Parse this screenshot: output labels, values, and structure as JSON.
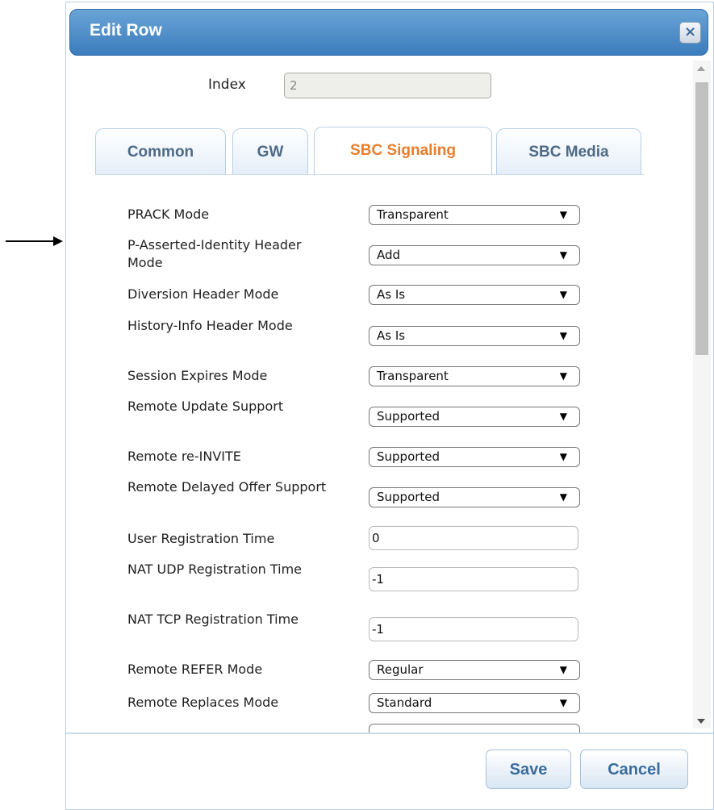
{
  "dialog": {
    "title": "Edit Row",
    "close_label": "×",
    "index": {
      "label": "Index",
      "value": "2"
    }
  },
  "tabs": [
    {
      "label": "Common",
      "active": false
    },
    {
      "label": "GW",
      "active": false
    },
    {
      "label": "SBC Signaling",
      "active": true
    },
    {
      "label": "SBC Media",
      "active": false
    }
  ],
  "fields": [
    {
      "label": "PRACK Mode",
      "type": "select",
      "value": "Transparent"
    },
    {
      "label": "P-Asserted-Identity Header Mode",
      "type": "select",
      "value": "Add"
    },
    {
      "label": "Diversion Header Mode",
      "type": "select",
      "value": "As Is"
    },
    {
      "label": "History-Info Header Mode",
      "type": "select",
      "value": "As Is"
    },
    {
      "label": "Session Expires Mode",
      "type": "select",
      "value": "Transparent"
    },
    {
      "label": "Remote Update Support",
      "type": "select",
      "value": "Supported"
    },
    {
      "label": "Remote re-INVITE",
      "type": "select",
      "value": "Supported"
    },
    {
      "label": "Remote Delayed Offer Support",
      "type": "select",
      "value": "Supported"
    },
    {
      "label": "User Registration Time",
      "type": "text",
      "value": "0"
    },
    {
      "label": "NAT UDP Registration Time",
      "type": "text",
      "value": "-1"
    },
    {
      "label": "NAT TCP Registration Time",
      "type": "text",
      "value": "-1"
    },
    {
      "label": "Remote REFER Mode",
      "type": "select",
      "value": "Regular"
    },
    {
      "label": "Remote Replaces Mode",
      "type": "select",
      "value": "Standard"
    }
  ],
  "select_caret": "▼",
  "footer": {
    "save_label": "Save",
    "cancel_label": "Cancel"
  },
  "colors": {
    "title_bar": "#3b7cbd",
    "active_tab_text": "#e87d2c",
    "tab_text": "#4d6a86",
    "button_text": "#3b6c9d"
  }
}
